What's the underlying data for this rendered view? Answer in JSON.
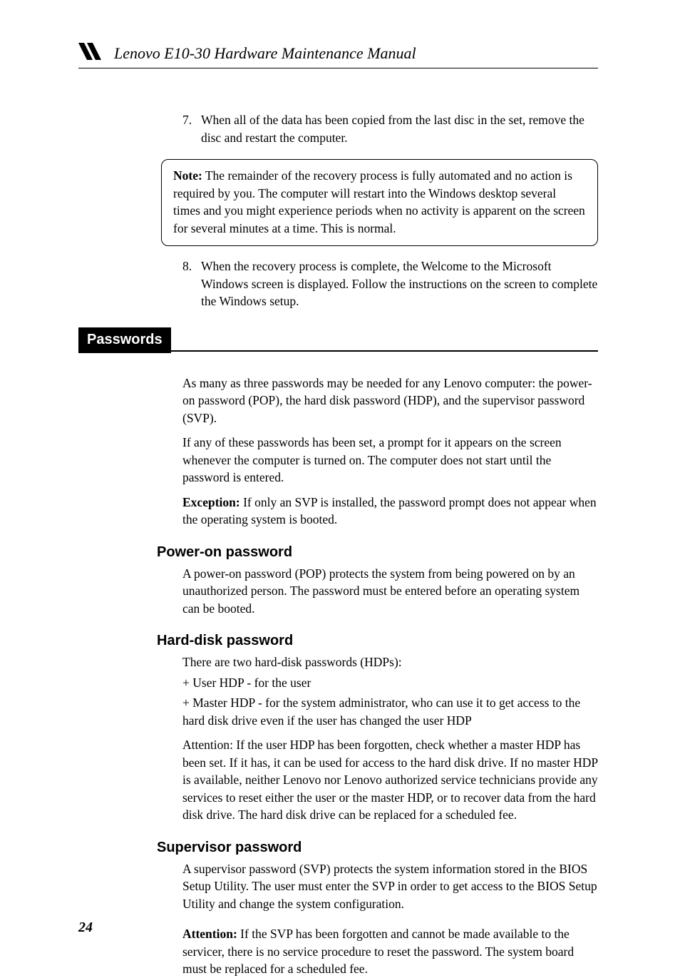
{
  "header": {
    "title": "Lenovo E10-30 Hardware Maintenance Manual"
  },
  "step7": {
    "num": "7.",
    "text": "When all of the data has been copied from the last disc in the set, remove the disc and restart the computer."
  },
  "noteBox": {
    "label": "Note:",
    "text": " The remainder of the recovery process is fully automated and no action is required by you. The computer will restart into the Windows desktop several times and you might experience periods when no activity is apparent on the screen for several minutes at a time. This is normal."
  },
  "step8": {
    "num": "8.",
    "text": "When the recovery process is complete, the Welcome to the Microsoft Windows screen is displayed. Follow the instructions on the screen to complete the Windows setup."
  },
  "sectionPasswords": {
    "label": "Passwords",
    "intro1": "As many as three passwords may be needed for any Lenovo computer: the power-on password (POP), the hard disk password (HDP), and the supervisor password (SVP).",
    "intro2": "If any of these passwords has been set, a prompt for it appears on the screen whenever the computer is turned on. The computer does not start until the password is entered.",
    "exceptionLabel": "Exception:",
    "exceptionText": " If only an SVP is installed, the password prompt does not appear when the operating system is booted."
  },
  "powerOn": {
    "heading": "Power-on password",
    "text": "A power-on password (POP) protects the system from being powered on by an unauthorized person. The password must be entered before an operating system can be booted."
  },
  "hardDisk": {
    "heading": "Hard-disk password",
    "line1": "There are two hard-disk passwords (HDPs):",
    "line2": "+ User HDP - for the user",
    "line3": "+ Master HDP - for the system administrator, who can use it to get access to the hard disk drive even if the user has changed the user HDP",
    "line4": "Attention: If the user HDP has been forgotten, check whether a master HDP has been set. If it has, it can be used for access to the hard disk drive. If no master HDP is available, neither Lenovo nor Lenovo authorized service technicians provide any services to reset either the user or the master HDP, or to recover data from the hard disk drive. The hard disk drive can be replaced for a scheduled fee."
  },
  "supervisor": {
    "heading": "Supervisor password",
    "text1": "A supervisor password (SVP) protects the system information stored in the BIOS Setup Utility. The user must enter the SVP in order to get access to the BIOS Setup Utility and change the system configuration.",
    "attentionLabel": "Attention:",
    "attentionText": " If the SVP has been forgotten and cannot be made available to the servicer, there is no service procedure to reset the password. The system board must be replaced for a scheduled fee."
  },
  "pageNumber": "24"
}
